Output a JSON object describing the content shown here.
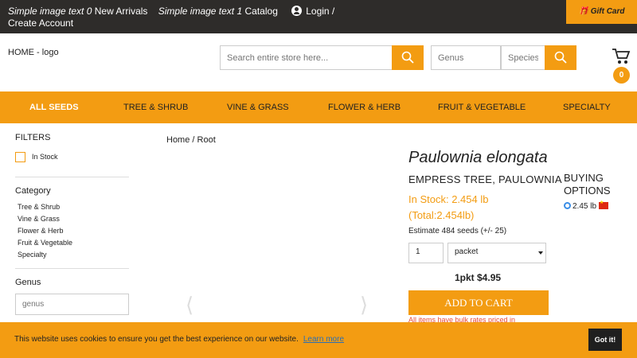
{
  "topbar": {
    "link1_italic": "Simple image text 0",
    "link1": "New Arrivals",
    "link2_italic": "Simple image text 1",
    "link2": "Catalog",
    "account": "Login / Create Account",
    "gift": "Gift Card"
  },
  "header": {
    "logo": "HOME - logo",
    "search_placeholder": "Search entire store here...",
    "genus_placeholder": "Genus",
    "species_placeholder": "Species",
    "cart_count": "0"
  },
  "nav": [
    "ALL SEEDS",
    "TREE & SHRUB",
    "VINE & GRASS",
    "FLOWER & HERB",
    "FRUIT & VEGETABLE",
    "SPECIALTY"
  ],
  "filters": {
    "title": "FILTERS",
    "instock": "In Stock",
    "category_title": "Category",
    "categories": [
      "Tree & Shrub",
      "Vine & Grass",
      "Flower & Herb",
      "Fruit & Vegetable",
      "Specialty"
    ],
    "genus_title": "Genus",
    "genus_placeholder": "genus"
  },
  "breadcrumb": "Home / Root",
  "product": {
    "name": "Paulownia elongata",
    "common": "EMPRESS TREE, PAULOWNIA",
    "stock": "In Stock: 2.454 lb",
    "total": "(Total:2.454lb)",
    "estimate": "Estimate 484 seeds (+/- 25)",
    "qty": "1",
    "unit": "packet",
    "price": "1pkt $4.95",
    "add_to_cart": "ADD TO CART",
    "bulk": "All items have bulk rates priced in"
  },
  "buying": {
    "title": "BUYING OPTIONS",
    "option": "2.45 lb"
  },
  "cookie": {
    "message": "This website uses cookies to ensure you get the best experience on our website.",
    "learn": "Learn more",
    "ok": "Got it!"
  },
  "colors": {
    "accent": "#f39c12",
    "dark": "#2e2c2a"
  }
}
